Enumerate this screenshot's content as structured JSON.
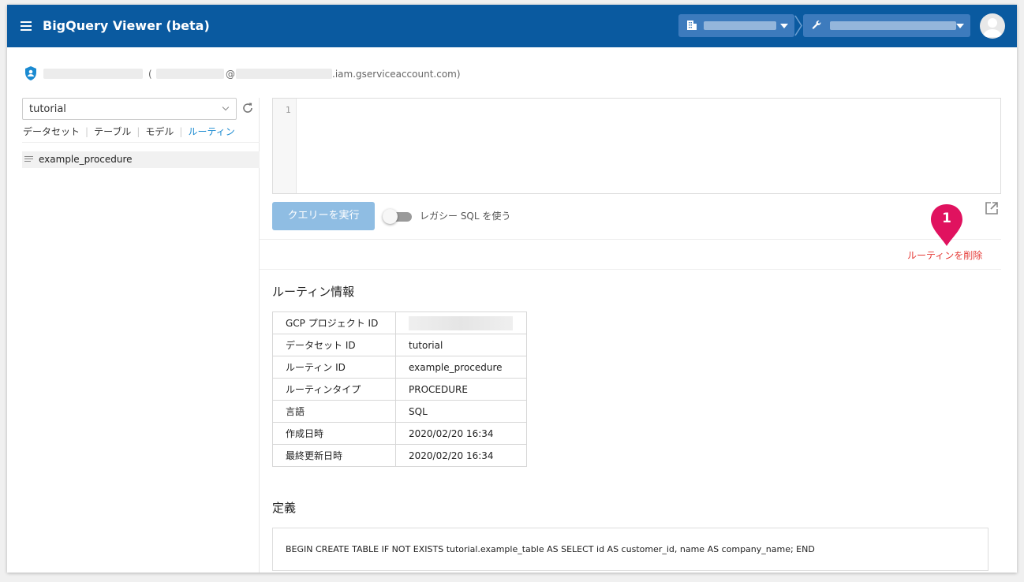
{
  "app": {
    "title": "BigQuery Viewer (beta)",
    "colors": {
      "header": "#0a5aa0",
      "accent": "#1a8ad1",
      "delete": "#e53935",
      "marker": "#e0125f"
    }
  },
  "account": {
    "open_paren": "(",
    "at": "@",
    "domain_suffix": ".iam.gserviceaccount.com)"
  },
  "sidebar": {
    "dataset_selected": "tutorial",
    "tabs": [
      {
        "label": "データセット",
        "active": false
      },
      {
        "label": "テーブル",
        "active": false
      },
      {
        "label": "モデル",
        "active": false
      },
      {
        "label": "ルーティン",
        "active": true
      }
    ],
    "routines": [
      {
        "name": "example_procedure"
      }
    ]
  },
  "editor": {
    "line_numbers": [
      "1"
    ],
    "content": "",
    "run_button": "クエリーを実行",
    "legacy_sql_label": "レガシー SQL を使う",
    "legacy_sql_enabled": false
  },
  "annotation": {
    "number": "1"
  },
  "actions": {
    "delete_routine": "ルーティンを削除"
  },
  "routine_info": {
    "title": "ルーティン情報",
    "rows": [
      {
        "key": "GCP プロジェクト ID",
        "value": ""
      },
      {
        "key": "データセット ID",
        "value": "tutorial"
      },
      {
        "key": "ルーティン ID",
        "value": "example_procedure"
      },
      {
        "key": "ルーティンタイプ",
        "value": "PROCEDURE"
      },
      {
        "key": "言語",
        "value": "SQL"
      },
      {
        "key": "作成日時",
        "value": "2020/02/20 16:34"
      },
      {
        "key": "最終更新日時",
        "value": "2020/02/20 16:34"
      }
    ]
  },
  "definition": {
    "title": "定義",
    "body": "BEGIN CREATE TABLE IF NOT EXISTS tutorial.example_table AS SELECT id AS customer_id, name AS company_name; END"
  }
}
